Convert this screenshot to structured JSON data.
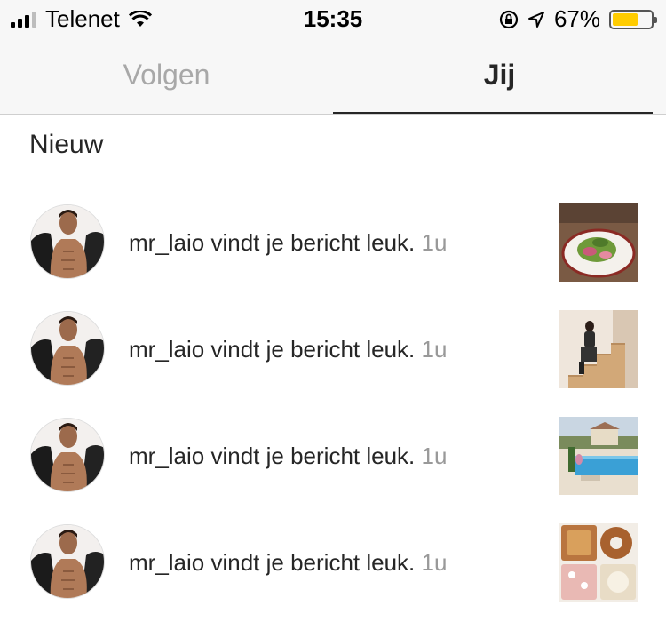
{
  "status_bar": {
    "carrier": "Telenet",
    "time": "15:35",
    "battery_percent": "67%",
    "battery_level": 0.67,
    "battery_color": "#ffcc00"
  },
  "tabs": [
    {
      "label": "Volgen",
      "active": false
    },
    {
      "label": "Jij",
      "active": true
    }
  ],
  "section": {
    "title": "Nieuw"
  },
  "notifications": [
    {
      "username": "mr_laio",
      "message": "vindt je bericht leuk.",
      "time": "1u",
      "thumbnail": "salad-plate-photo"
    },
    {
      "username": "mr_laio",
      "message": "vindt je bericht leuk.",
      "time": "1u",
      "thumbnail": "woman-on-stairs-photo"
    },
    {
      "username": "mr_laio",
      "message": "vindt je bericht leuk.",
      "time": "1u",
      "thumbnail": "pool-photo"
    },
    {
      "username": "mr_laio",
      "message": "vindt je bericht leuk.",
      "time": "1u",
      "thumbnail": "pastries-box-photo"
    }
  ]
}
